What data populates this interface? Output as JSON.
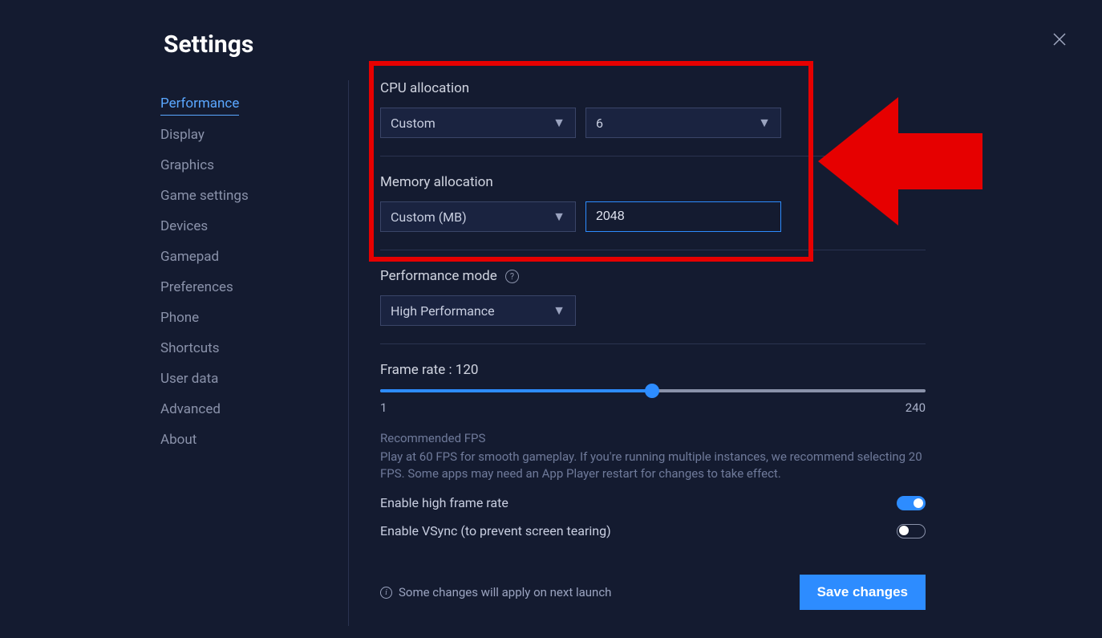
{
  "title": "Settings",
  "sidebar": {
    "items": [
      {
        "label": "Performance",
        "active": true
      },
      {
        "label": "Display"
      },
      {
        "label": "Graphics"
      },
      {
        "label": "Game settings"
      },
      {
        "label": "Devices"
      },
      {
        "label": "Gamepad"
      },
      {
        "label": "Preferences"
      },
      {
        "label": "Phone"
      },
      {
        "label": "Shortcuts"
      },
      {
        "label": "User data"
      },
      {
        "label": "Advanced"
      },
      {
        "label": "About"
      }
    ]
  },
  "cpu": {
    "label": "CPU allocation",
    "mode": "Custom",
    "value": "6"
  },
  "memory": {
    "label": "Memory allocation",
    "mode": "Custom (MB)",
    "value": "2048"
  },
  "perf_mode": {
    "label": "Performance mode",
    "value": "High Performance"
  },
  "framerate": {
    "label": "Frame rate : 120",
    "min": "1",
    "max": "240",
    "value": 120,
    "percent": 49.8
  },
  "recommended": {
    "title": "Recommended FPS",
    "text": "Play at 60 FPS for smooth gameplay. If you're running multiple instances, we recommend selecting 20 FPS. Some apps may need an App Player restart for changes to take effect."
  },
  "toggles": {
    "high_frame": {
      "label": "Enable high frame rate",
      "on": true
    },
    "vsync": {
      "label": "Enable VSync (to prevent screen tearing)",
      "on": false
    }
  },
  "footer": {
    "note": "Some changes will apply on next launch",
    "save": "Save changes"
  }
}
